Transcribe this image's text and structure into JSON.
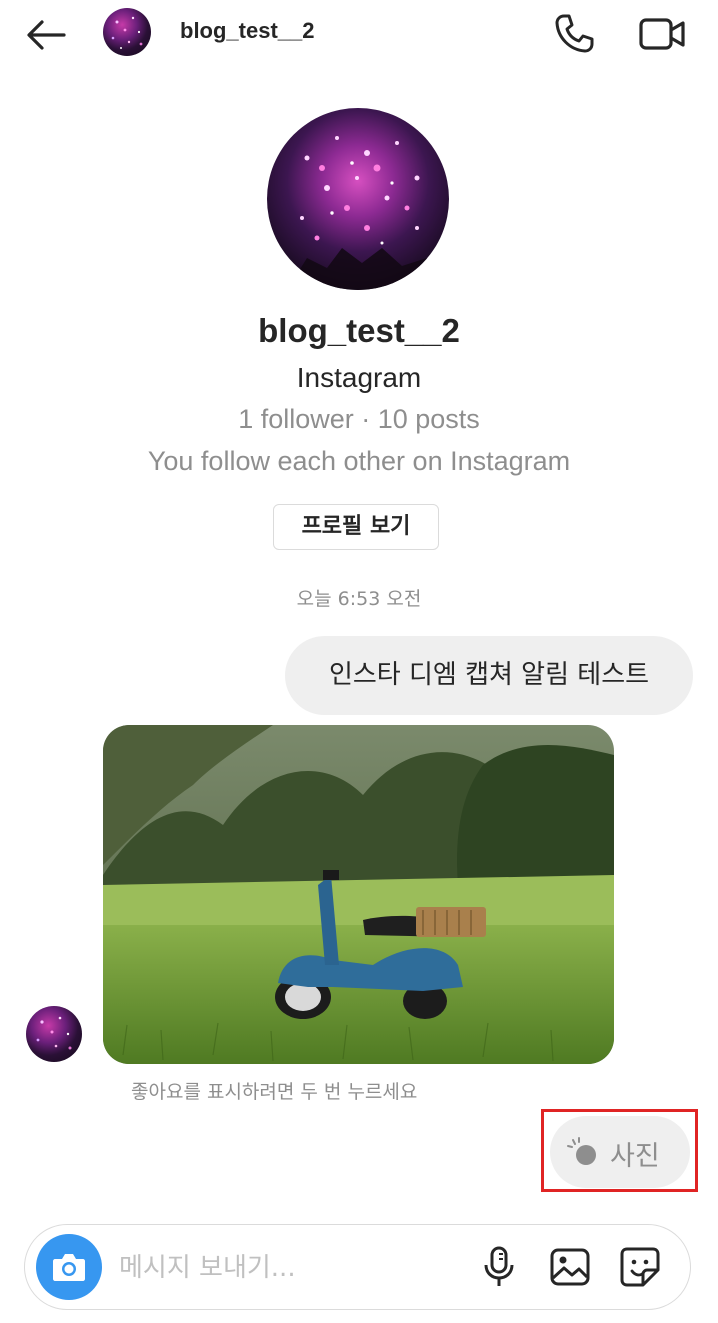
{
  "header": {
    "username": "blog_test__2",
    "icons": {
      "back": "arrow-left-icon",
      "call": "phone-icon",
      "video": "video-camera-icon"
    }
  },
  "profile": {
    "name": "blog_test__2",
    "platform": "Instagram",
    "stats": "1 follower · 10 posts",
    "relation": "You follow each other on Instagram",
    "view_profile_label": "프로필 보기"
  },
  "conversation": {
    "timestamp": "오늘 6:53 오전",
    "sent_message": "인스타 디엠 캡쳐 알림 테스트",
    "photo_hint": "좋아요를 표시하려면 두 번 누르세요",
    "photo_chip_label": "사진"
  },
  "composer": {
    "placeholder": "메시지 보내기...",
    "icons": {
      "camera": "camera-icon",
      "mic": "microphone-icon",
      "gallery": "gallery-icon",
      "sticker": "sticker-icon"
    }
  },
  "colors": {
    "accent_blue": "#3797f0",
    "highlight_red": "#e02424",
    "bubble_gray": "#efefef",
    "secondary_text": "#8e8e8e"
  }
}
